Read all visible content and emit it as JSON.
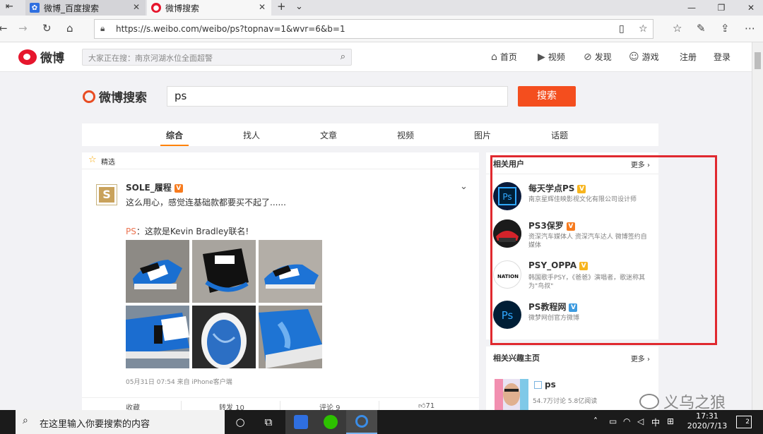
{
  "browser": {
    "tabs": [
      {
        "title": "微博_百度搜索",
        "icon": "baidu-paw-icon"
      },
      {
        "title": "微博搜索",
        "icon": "weibo-icon"
      }
    ],
    "url": "https://s.weibo.com/weibo/ps?topnav=1&wvr=6&b=1"
  },
  "weibo_header": {
    "logo_text": "微博",
    "search_placeholder": "大家正在搜：南京河湖水位全面超警",
    "nav": [
      {
        "label": "首页",
        "icon": "home-icon"
      },
      {
        "label": "视频",
        "icon": "video-icon"
      },
      {
        "label": "发现",
        "icon": "compass-icon"
      },
      {
        "label": "游戏",
        "icon": "gamepad-icon"
      },
      {
        "label": "注册"
      },
      {
        "label": "登录"
      }
    ]
  },
  "search": {
    "logo_text": "微博搜索",
    "query": "ps",
    "button_label": "搜索"
  },
  "result_tabs": [
    "综合",
    "找人",
    "文章",
    "视频",
    "图片",
    "话题"
  ],
  "active_tab": "综合",
  "feed": {
    "featured_label": "精选",
    "post": {
      "avatar_letter": "S",
      "author": "SOLE_履程",
      "badge": "V",
      "text": "这么用心，感觉连基础款都要买不起了......",
      "ps_prefix": "PS",
      "ps_text": "：这款是Kevin Bradley联名!",
      "meta": "05月31日 07:54  来自 iPhone客户端",
      "actions": [
        "收藏",
        "转发 10",
        "评论 9",
        "71"
      ]
    }
  },
  "related_users": {
    "title": "相关用户",
    "more": "更多",
    "users": [
      {
        "name": "每天学点PS",
        "badge": "gold",
        "desc": "南京星辉佳映影视文化有限公司设计师",
        "avatar_text": "Ps"
      },
      {
        "name": "PS3保罗",
        "badge": "orange",
        "desc": "资深汽车媒体人 资深汽车达人 微博签约自媒体",
        "avatar_text": ""
      },
      {
        "name": "PSY_OPPA",
        "badge": "gold",
        "desc": "韩国歌手PSY，《爸爸》演唱者，歌迷称其为\"鸟叔\"",
        "avatar_text": "NATION"
      },
      {
        "name": "PS教程网",
        "badge": "blue",
        "desc": "微梦网创官方微博",
        "avatar_text": "Ps"
      }
    ]
  },
  "related_topics": {
    "title": "相关兴趣主页",
    "more": "更多",
    "topic": {
      "name": "ps",
      "stats": "54.7万讨论 5.8亿阅读"
    }
  },
  "watermark": "义乌之狼",
  "taskbar": {
    "search_placeholder": "在这里输入你要搜索的内容",
    "ime": "中",
    "time": "17:31",
    "date": "2020/7/13",
    "notifications": "2"
  }
}
